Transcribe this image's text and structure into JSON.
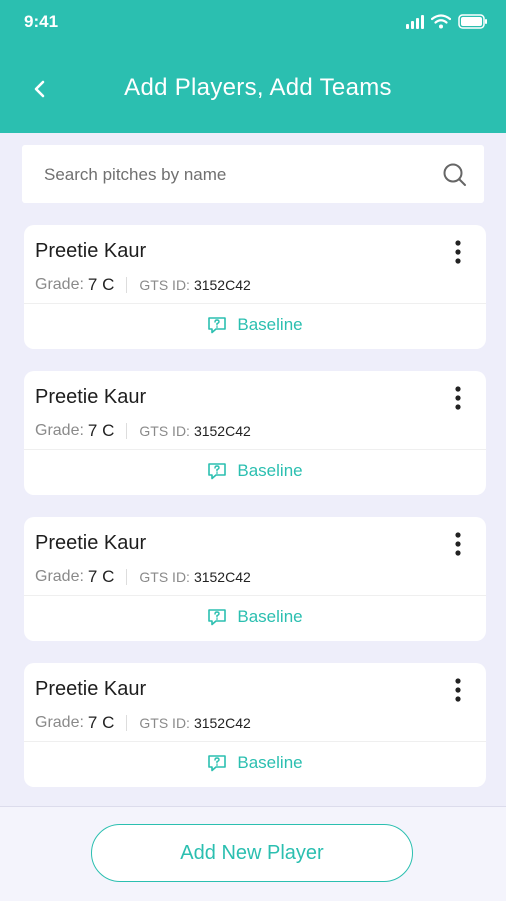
{
  "status_bar": {
    "time": "9:41"
  },
  "header": {
    "title": "Add Players, Add Teams"
  },
  "search": {
    "placeholder": "Search pitches by name",
    "value": ""
  },
  "players": [
    {
      "name": "Preetie Kaur",
      "grade_label": "Grade:",
      "grade": "7 C",
      "gts_label": "GTS ID:",
      "gts_id": "3152C42",
      "action_label": "Baseline"
    },
    {
      "name": "Preetie Kaur",
      "grade_label": "Grade:",
      "grade": "7 C",
      "gts_label": "GTS ID:",
      "gts_id": "3152C42",
      "action_label": "Baseline"
    },
    {
      "name": "Preetie Kaur",
      "grade_label": "Grade:",
      "grade": "7 C",
      "gts_label": "GTS ID:",
      "gts_id": "3152C42",
      "action_label": "Baseline"
    },
    {
      "name": "Preetie Kaur",
      "grade_label": "Grade:",
      "grade": "7 C",
      "gts_label": "GTS ID:",
      "gts_id": "3152C42",
      "action_label": "Baseline"
    }
  ],
  "footer": {
    "add_button_label": "Add New Player"
  },
  "colors": {
    "accent": "#2bbfb0",
    "background": "#eeeefa"
  },
  "icons": [
    "back-arrow-icon",
    "search-icon",
    "more-vertical-icon",
    "baseline-icon",
    "signal-icon",
    "wifi-icon",
    "battery-icon"
  ]
}
